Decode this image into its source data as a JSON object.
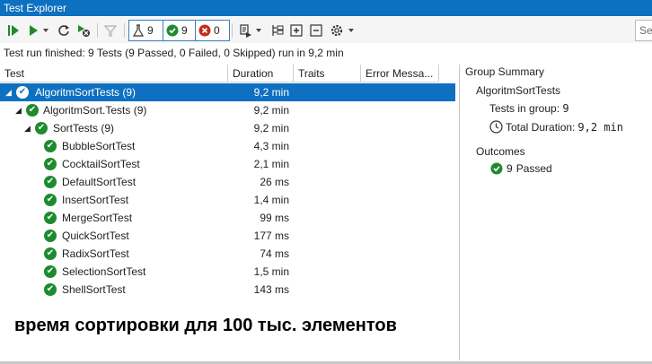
{
  "window": {
    "title": "Test Explorer"
  },
  "toolbar": {
    "counters": {
      "total": "9",
      "passed": "9",
      "failed": "0"
    },
    "search_placeholder": "Se"
  },
  "status": "Test run finished: 9 Tests (9 Passed, 0 Failed, 0 Skipped) run in 9,2 min",
  "grid": {
    "columns": [
      "Test",
      "Duration",
      "Traits",
      "Error Messa..."
    ],
    "rows": [
      {
        "name": "AlgoritmSortTests  (9)",
        "duration": "9,2 min"
      },
      {
        "name": "AlgoritmSort.Tests  (9)",
        "duration": "9,2 min"
      },
      {
        "name": "SortTests  (9)",
        "duration": "9,2 min"
      },
      {
        "name": "BubbleSortTest",
        "duration": "4,3 min"
      },
      {
        "name": "CocktailSortTest",
        "duration": "2,1 min"
      },
      {
        "name": "DefaultSortTest",
        "duration": "26 ms"
      },
      {
        "name": "InsertSortTest",
        "duration": "1,4 min"
      },
      {
        "name": "MergeSortTest",
        "duration": "99 ms"
      },
      {
        "name": "QuickSortTest",
        "duration": "177 ms"
      },
      {
        "name": "RadixSortTest",
        "duration": "74 ms"
      },
      {
        "name": "SelectionSortTest",
        "duration": "1,5 min"
      },
      {
        "name": "ShellSortTest",
        "duration": "143 ms"
      }
    ]
  },
  "summary": {
    "title": "Group Summary",
    "group_name": "AlgoritmSortTests",
    "tests_in_group_label": "Tests in group:",
    "tests_in_group_value": "9",
    "total_duration_label": "Total Duration:",
    "total_duration_value": "9,2 min",
    "outcomes_label": "Outcomes",
    "passed_count": "9",
    "passed_label": "Passed"
  },
  "caption": "время сортировки для 100 тыс. элементов",
  "colors": {
    "accent": "#0e70c0",
    "pass": "#1e8b2f",
    "fail": "#c42b1c"
  }
}
